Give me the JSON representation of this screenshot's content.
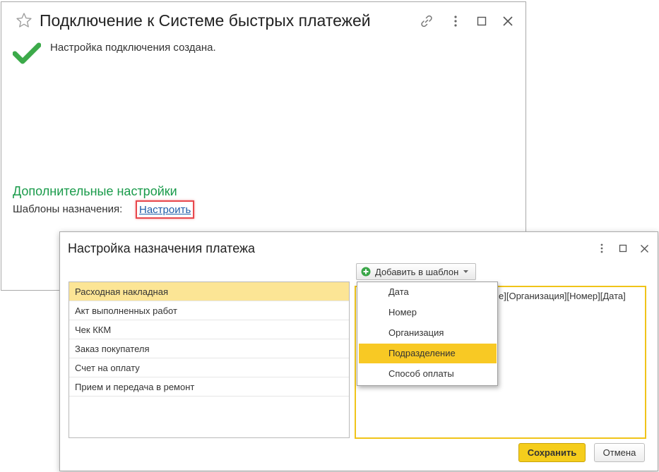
{
  "window1": {
    "title": "Подключение к Системе быстрых платежей",
    "status_message": "Настройка подключения создана.",
    "section_title": "Дополнительные настройки",
    "templates_label": "Шаблоны назначения:",
    "configure_link": "Настроить",
    "icons": [
      "star-icon",
      "link-icon",
      "more-icon",
      "maximize-icon",
      "close-icon",
      "checkmark-icon"
    ]
  },
  "window2": {
    "title": "Настройка назначения платежа",
    "add_button_label": "Добавить в шаблон",
    "documents": [
      {
        "label": "Расходная накладная",
        "selected": true
      },
      {
        "label": "Акт выполненных работ"
      },
      {
        "label": "Чек ККМ"
      },
      {
        "label": "Заказ покупателя"
      },
      {
        "label": "Счет на оплату"
      },
      {
        "label": "Прием и передача в ремонт"
      }
    ],
    "template_text": "е][Организация][Номер][Дата]",
    "dropdown_items": [
      {
        "label": "Дата"
      },
      {
        "label": "Номер"
      },
      {
        "label": "Организация"
      },
      {
        "label": "Подразделение",
        "active": true
      },
      {
        "label": "Способ оплаты"
      }
    ],
    "save_label": "Сохранить",
    "cancel_label": "Отмена"
  },
  "colors": {
    "accent_green": "#1a9b4b",
    "link_blue": "#1f5ca8",
    "highlight_red": "#e8484d",
    "selected_row": "#fce595",
    "active_yellow": "#f8c924",
    "save_button": "#f5cd1c"
  }
}
